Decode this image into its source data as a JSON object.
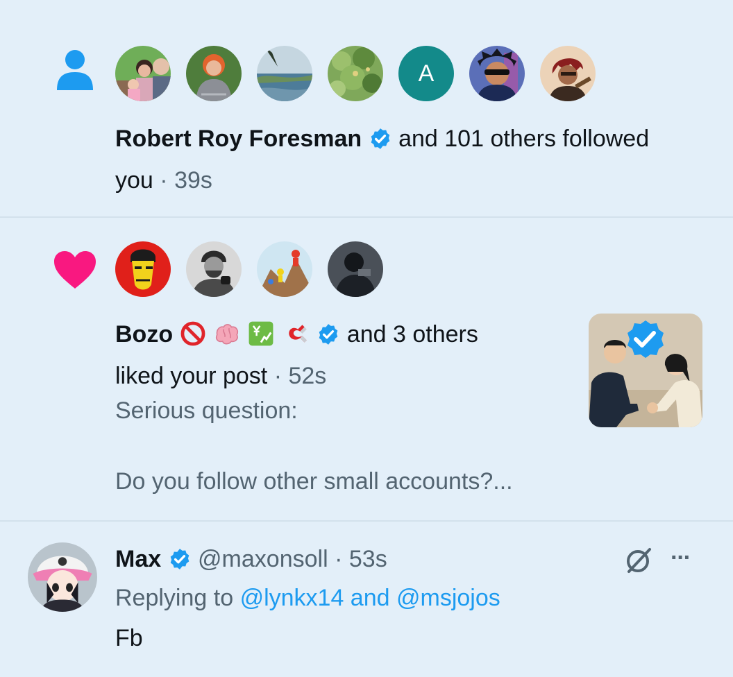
{
  "notifications": {
    "follow": {
      "type_icon": "person-icon",
      "avatars": [
        "family-photo",
        "woman-red-hair",
        "coastal-landscape",
        "green-foliage",
        "letter-avatar",
        "anime-sunglasses",
        "anime-red-hair"
      ],
      "letter_avatar": "A",
      "actor_name": "Robert Roy Foresman",
      "text_line1": "and 101 others followed",
      "text_line2": "you",
      "separator": "·",
      "time": "39s"
    },
    "like": {
      "type_icon": "heart-icon",
      "avatars": [
        "cartoon-yellow-face",
        "man-beard-bw",
        "climbing-cartoon",
        "dark-figure"
      ],
      "actor_name": "Bozo",
      "name_emojis": [
        "prohibited-icon",
        "brain-icon",
        "chart-yen-icon",
        "magnet-icon"
      ],
      "others_text": "and 3 others",
      "action_text": "liked your post",
      "separator": "·",
      "time": "52s",
      "post_line1": "Serious question:",
      "post_line2": "Do you follow other small accounts?...",
      "thumbnail": "handshake-illustration"
    },
    "reply": {
      "avatar": "anime-pink-cap",
      "name": "Max",
      "handle": "@maxonsoll",
      "separator": "·",
      "time": "53s",
      "replying_prefix": "Replying to",
      "replying_users": "@lynkx14 and @msjojos",
      "body": "Fb",
      "more_label": "···"
    }
  },
  "colors": {
    "background": "#e3eff9",
    "accent": "#1d9bf0",
    "like": "#f91880",
    "muted": "#536471"
  }
}
